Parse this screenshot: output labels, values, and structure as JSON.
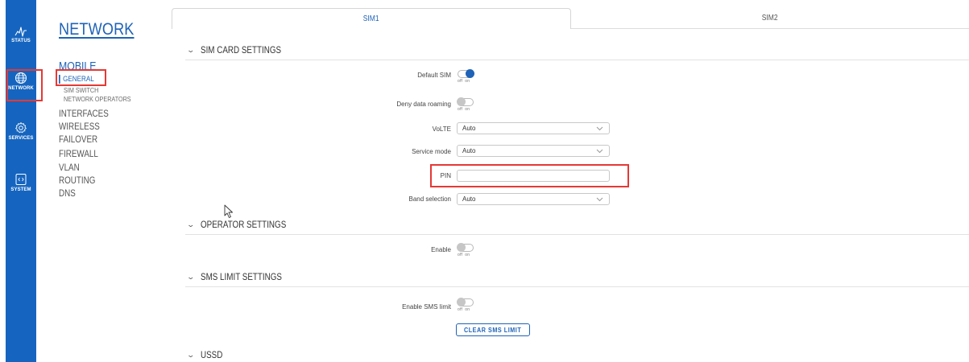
{
  "rail": {
    "items": [
      {
        "label": "STATUS",
        "icon": "status-icon"
      },
      {
        "label": "NETWORK",
        "icon": "globe-icon"
      },
      {
        "label": "SERVICES",
        "icon": "gear-icon"
      },
      {
        "label": "SYSTEM",
        "icon": "system-icon"
      }
    ]
  },
  "nav": {
    "title": "NETWORK",
    "section": "MOBILE",
    "sub": [
      "GENERAL",
      "SIM SWITCH",
      "NETWORK OPERATORS"
    ],
    "items": [
      "INTERFACES",
      "WIRELESS",
      "FAILOVER",
      "FIREWALL",
      "VLAN",
      "ROUTING",
      "DNS"
    ]
  },
  "tabs": [
    "SIM1",
    "SIM2"
  ],
  "sections": {
    "sim_card": "SIM CARD SETTINGS",
    "operator": "OPERATOR SETTINGS",
    "sms_limit": "SMS LIMIT SETTINGS",
    "ussd": "USSD"
  },
  "fields": {
    "default_sim": "Default SIM",
    "deny_roaming": "Deny data roaming",
    "volte": "VoLTE",
    "volte_value": "Auto",
    "service_mode": "Service mode",
    "service_mode_value": "Auto",
    "pin": "PIN",
    "pin_value": "",
    "band_selection": "Band selection",
    "band_selection_value": "Auto",
    "enable": "Enable",
    "enable_sms_limit": "Enable SMS limit",
    "off": "off",
    "on": "on"
  },
  "toggles": {
    "default_sim": true,
    "deny_roaming": false,
    "operator_enable": false,
    "sms_limit": false
  },
  "buttons": {
    "clear_sms_limit": "CLEAR SMS LIMIT"
  },
  "colors": {
    "accent": "#1e63b8",
    "rail": "#1565c0",
    "highlight": "#e53935"
  }
}
